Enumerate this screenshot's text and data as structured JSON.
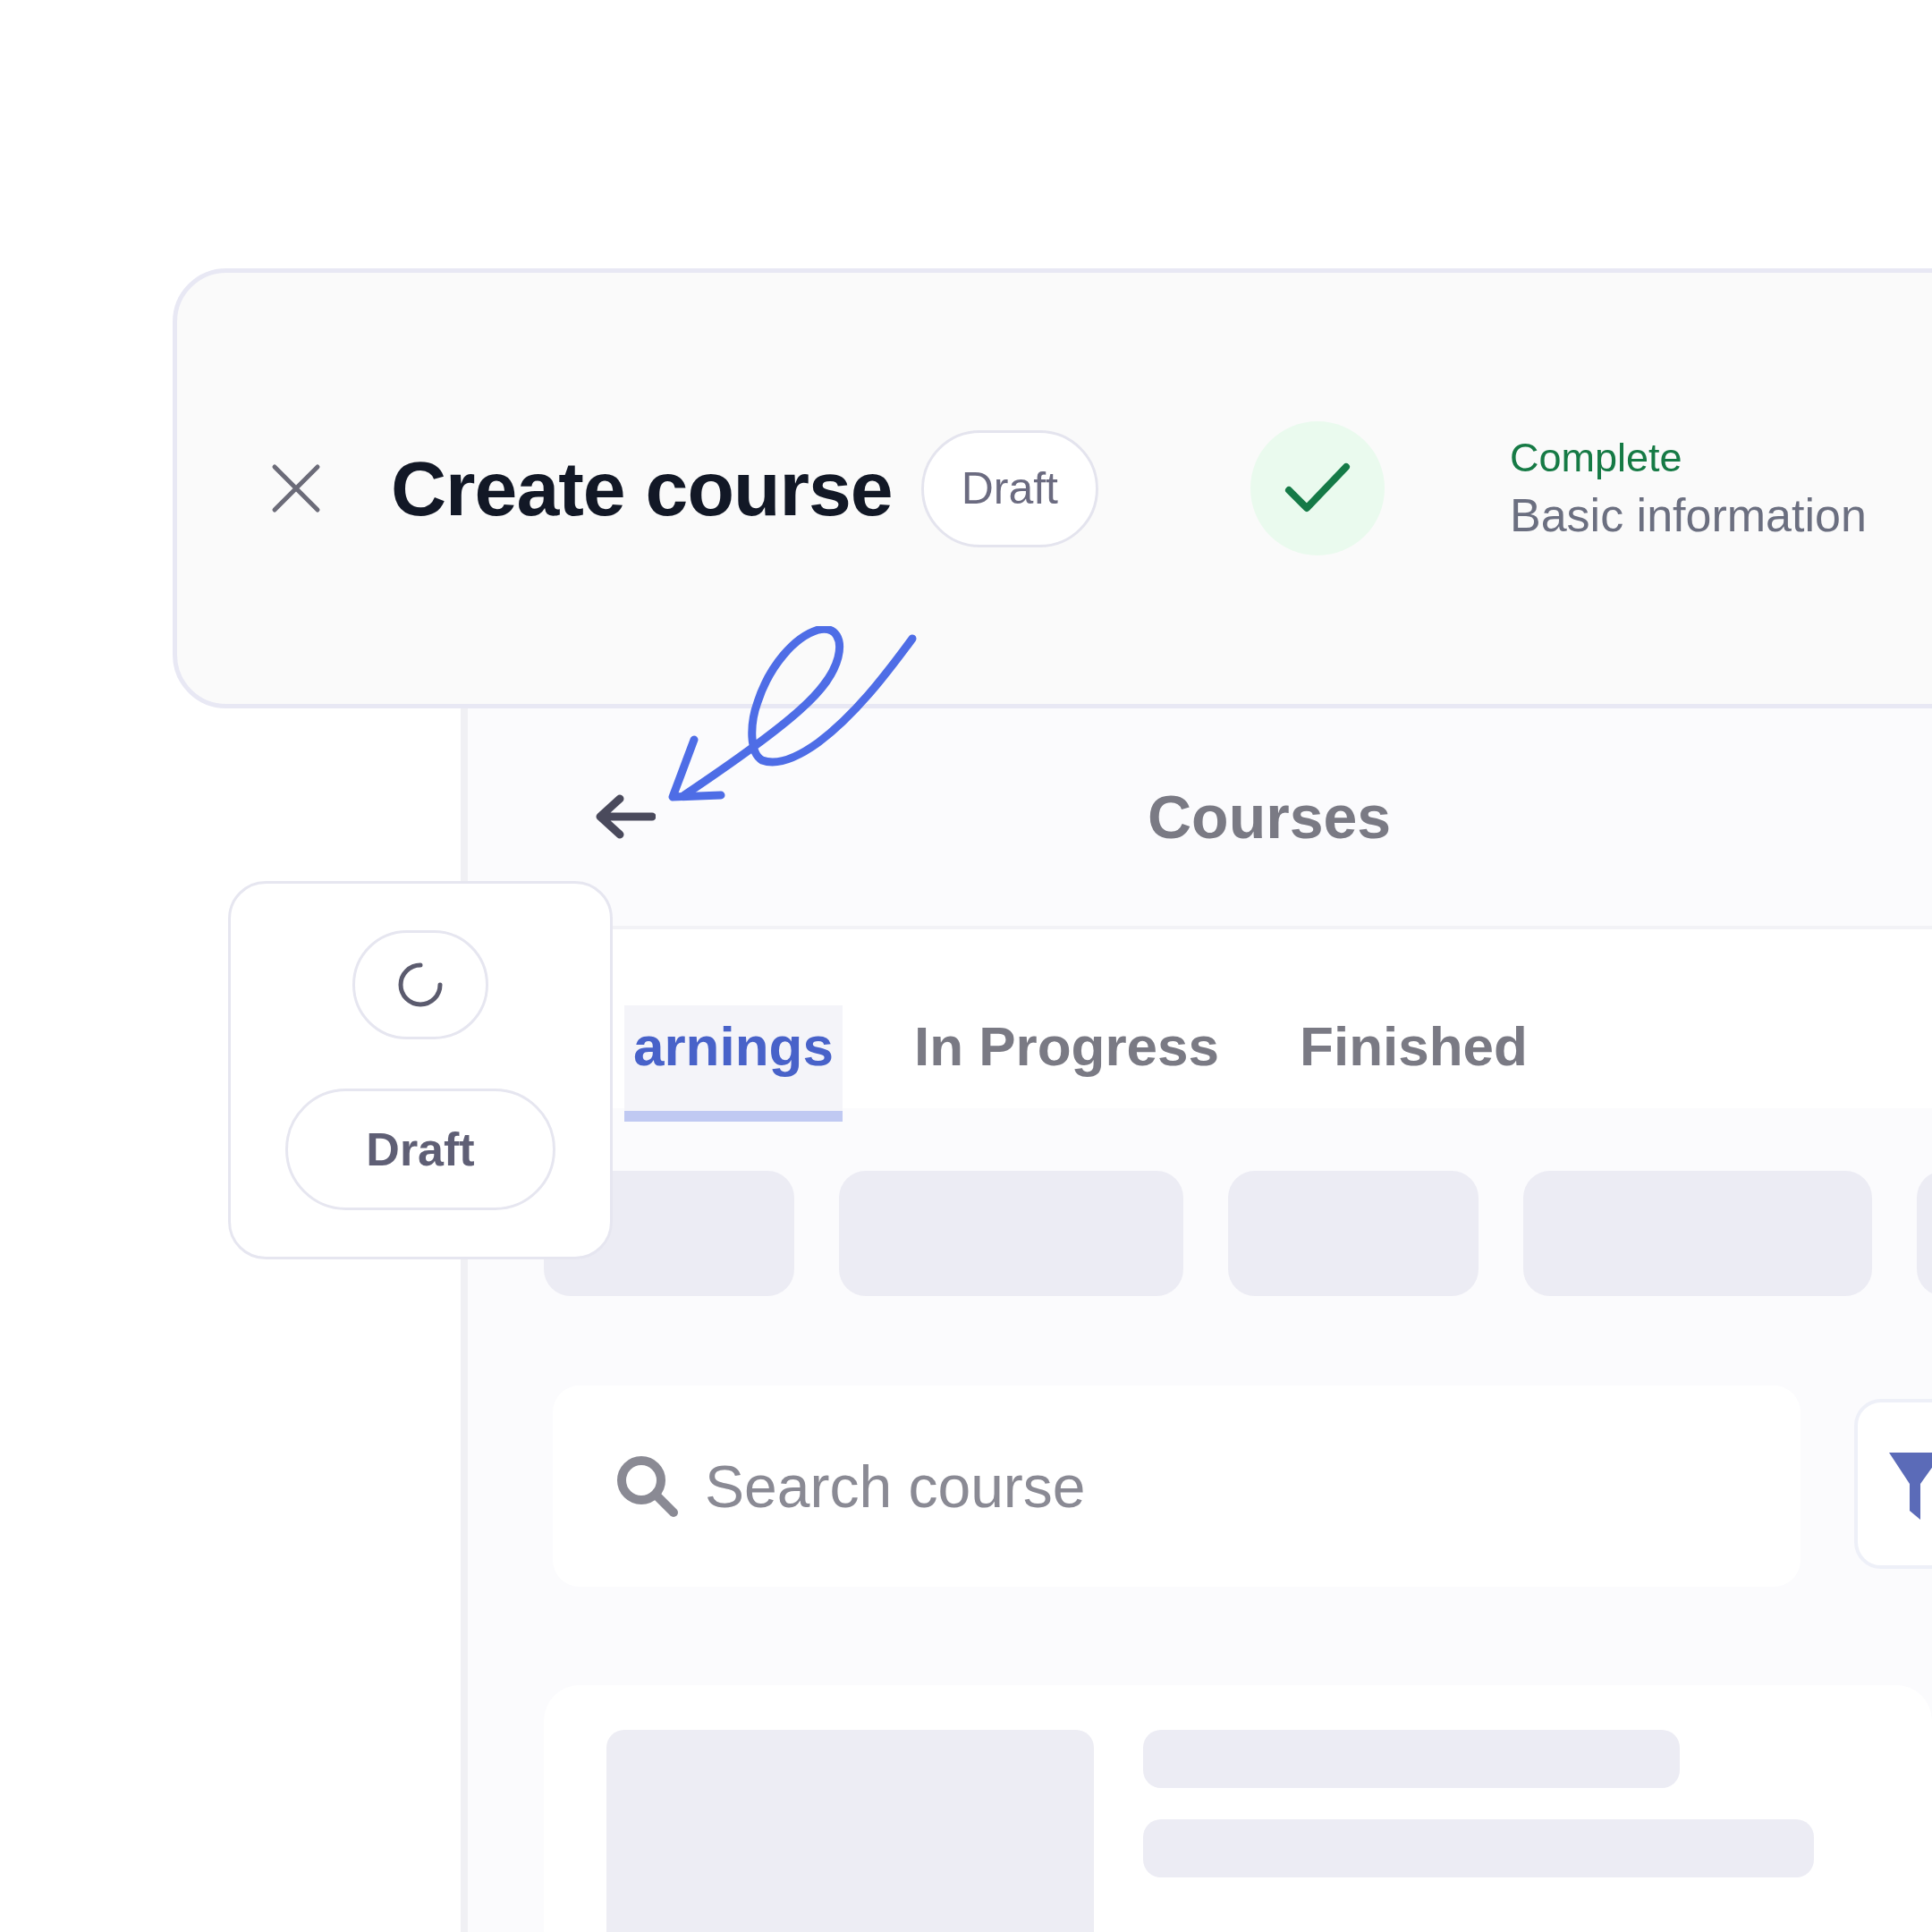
{
  "header": {
    "title": "Create course",
    "status_badge": "Draft",
    "step": {
      "state": "Complete",
      "name": "Basic information",
      "completed": true
    }
  },
  "status_popover": {
    "loading": true,
    "button": "Draft"
  },
  "background_page": {
    "title": "Courses",
    "tabs": [
      {
        "label": "arnings",
        "selected": true
      },
      {
        "label": "In Progress",
        "selected": false
      },
      {
        "label": "Finished",
        "selected": false
      }
    ],
    "search": {
      "placeholder": "Search course"
    }
  }
}
